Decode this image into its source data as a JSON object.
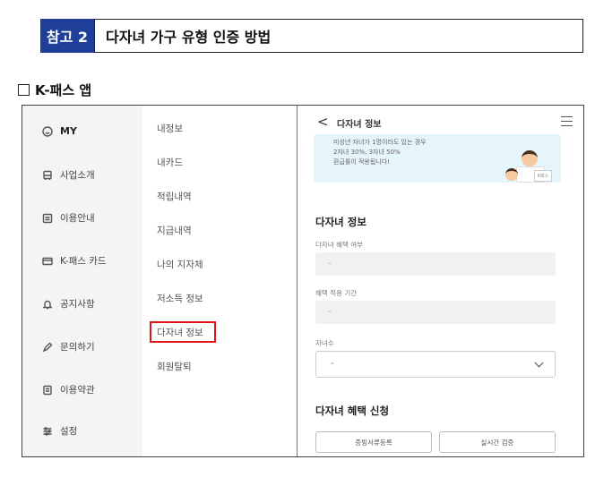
{
  "header": {
    "badge": "참고 2",
    "title": "다자녀 가구 유형 인증 방법"
  },
  "section": {
    "title": "K-패스 앱"
  },
  "app": {
    "nav": [
      {
        "label": "MY",
        "icon": "smile-icon"
      },
      {
        "label": "사업소개",
        "icon": "bus-icon"
      },
      {
        "label": "이용안내",
        "icon": "guide-icon"
      },
      {
        "label": "K-패스 카드",
        "icon": "card-icon"
      },
      {
        "label": "공지사항",
        "icon": "bell-icon"
      },
      {
        "label": "문의하기",
        "icon": "pen-icon"
      },
      {
        "label": "이용약관",
        "icon": "document-icon"
      },
      {
        "label": "설정",
        "icon": "settings-icon"
      }
    ],
    "submenu": [
      "내정보",
      "내카드",
      "적립내역",
      "지급내역",
      "나의 지자체",
      "저소득 정보",
      "다자녀 정보",
      "회원탈퇴"
    ],
    "highlight_color": "#e0151c",
    "detail": {
      "back_icon": "<",
      "page_title": "다자녀 정보",
      "banner": [
        "미성년 자녀가 1명이라도 있는 경우",
        "2자녀 30%, 3자녀 50%",
        "환급률이 적용됩니다!"
      ],
      "banner_card": "K패스",
      "section_title": "다자녀 정보",
      "fields": [
        {
          "label": "다자녀 혜택 여부",
          "value": "-"
        },
        {
          "label": "혜택 적용 기간",
          "value": "-"
        }
      ],
      "children_label": "자녀수",
      "children_value": "-",
      "apply_title": "다자녀 혜택 신청",
      "buttons": [
        "증빙서류등록",
        "실시간 검증"
      ]
    }
  }
}
